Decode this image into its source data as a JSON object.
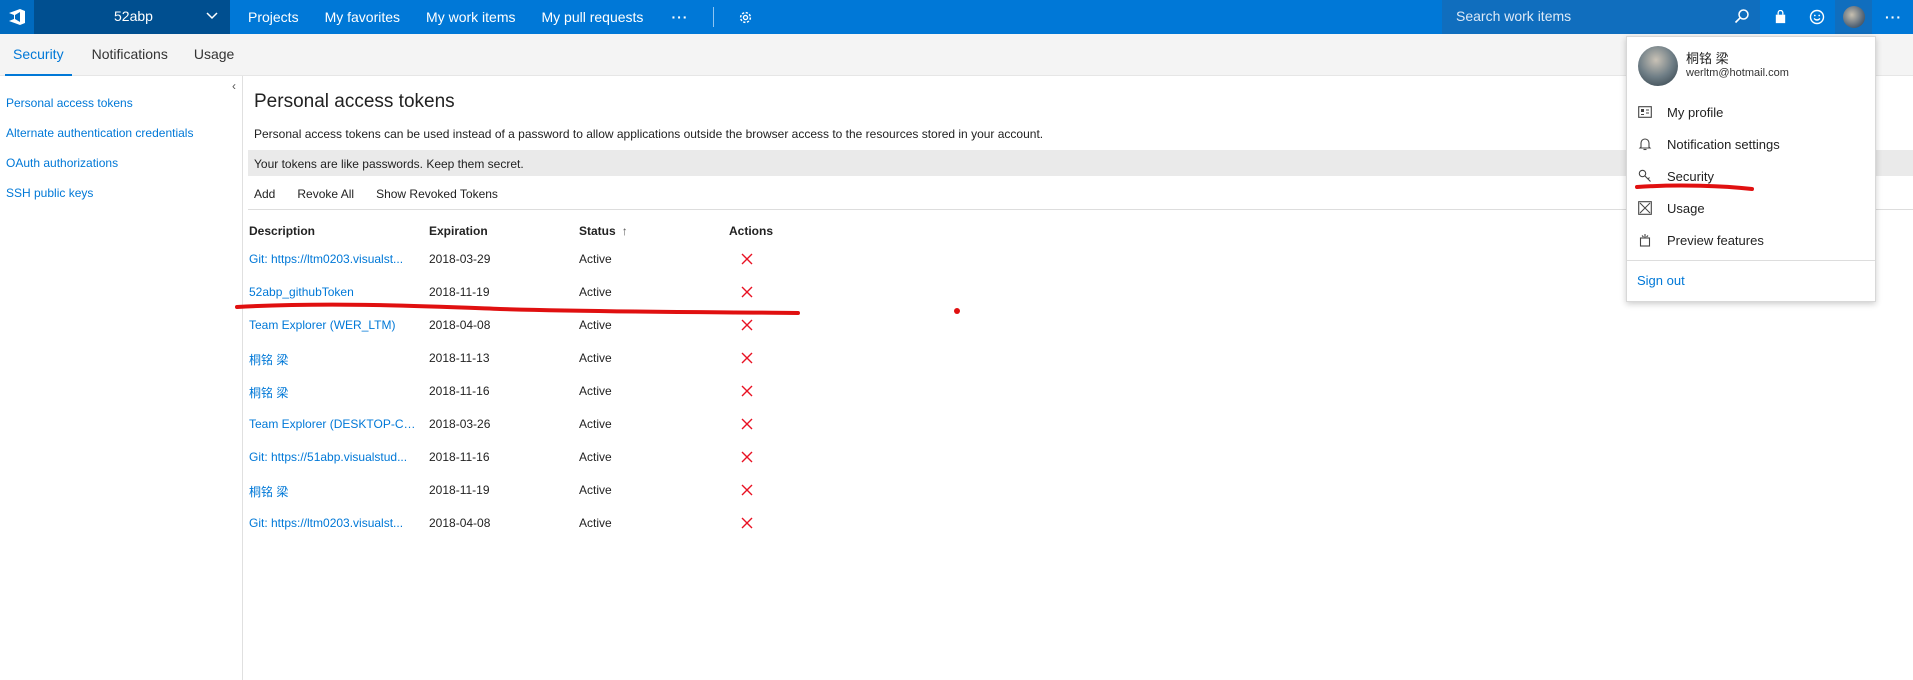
{
  "topbar": {
    "account_name": "52abp",
    "nav": [
      "Projects",
      "My favorites",
      "My work items",
      "My pull requests"
    ],
    "more": "···",
    "search_placeholder": "Search work items",
    "accent": "#0078d7"
  },
  "subnav": {
    "tabs": [
      "Security",
      "Notifications",
      "Usage"
    ],
    "active": "Security"
  },
  "sidebar": {
    "items": [
      "Personal access tokens",
      "Alternate authentication credentials",
      "OAuth authorizations",
      "SSH public keys"
    ]
  },
  "main": {
    "title": "Personal access tokens",
    "description": "Personal access tokens can be used instead of a password to allow applications outside the browser access to the resources stored in your account.",
    "banner": "Your tokens are like passwords. Keep them secret.",
    "toolbar": [
      "Add",
      "Revoke All",
      "Show Revoked Tokens"
    ],
    "columns": {
      "description": "Description",
      "expiration": "Expiration",
      "status": "Status",
      "actions": "Actions"
    },
    "rows": [
      {
        "description": "Git: https://ltm0203.visualst...",
        "expiration": "2018-03-29",
        "status": "Active"
      },
      {
        "description": "52abp_githubToken",
        "expiration": "2018-11-19",
        "status": "Active"
      },
      {
        "description": "Team Explorer (WER_LTM)",
        "expiration": "2018-04-08",
        "status": "Active"
      },
      {
        "description": "桐铭 梁",
        "expiration": "2018-11-13",
        "status": "Active"
      },
      {
        "description": "桐铭 梁",
        "expiration": "2018-11-16",
        "status": "Active"
      },
      {
        "description": "Team Explorer (DESKTOP-CK...",
        "expiration": "2018-03-26",
        "status": "Active"
      },
      {
        "description": "Git: https://51abp.visualstud...",
        "expiration": "2018-11-16",
        "status": "Active"
      },
      {
        "description": "桐铭 梁",
        "expiration": "2018-11-19",
        "status": "Active"
      },
      {
        "description": "Git: https://ltm0203.visualst...",
        "expiration": "2018-04-08",
        "status": "Active"
      }
    ]
  },
  "profile_menu": {
    "name": "桐铭 梁",
    "email": "werltm@hotmail.com",
    "items": [
      "My profile",
      "Notification settings",
      "Security",
      "Usage",
      "Preview features"
    ],
    "sign_out": "Sign out"
  }
}
